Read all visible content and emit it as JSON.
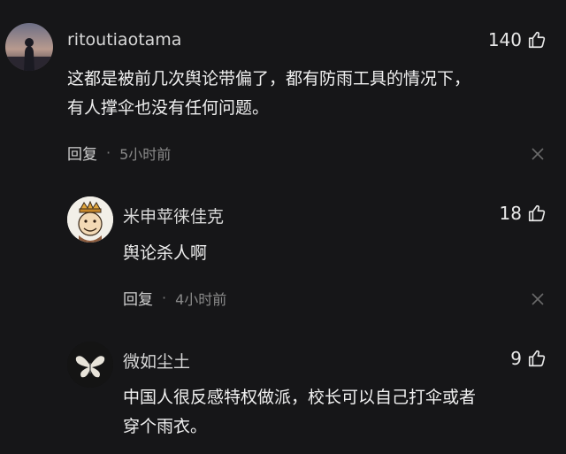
{
  "comments": [
    {
      "username": "ritoutiaotama",
      "likes": "140",
      "text_lines": [
        "这都是被前几次舆论带偏了，都有防雨工具的情况下，",
        "有人撑伞也没有任何问题。"
      ],
      "reply_label": "回复",
      "separator": "·",
      "time": "5小时前"
    },
    {
      "username": "米申苹徕佳克",
      "likes": "18",
      "text_lines": [
        "舆论杀人啊"
      ],
      "reply_label": "回复",
      "separator": "·",
      "time": "4小时前"
    },
    {
      "username": "微如尘土",
      "likes": "9",
      "text_lines": [
        "中国人很反感特权做派，校长可以自己打伞或者",
        "穿个雨衣。"
      ]
    }
  ],
  "icons": {
    "like": "thumb-up-icon",
    "dismiss": "close-icon"
  },
  "colors": {
    "background": "#161618",
    "text": "#f0f0f0",
    "secondary": "#8a8a8a"
  }
}
